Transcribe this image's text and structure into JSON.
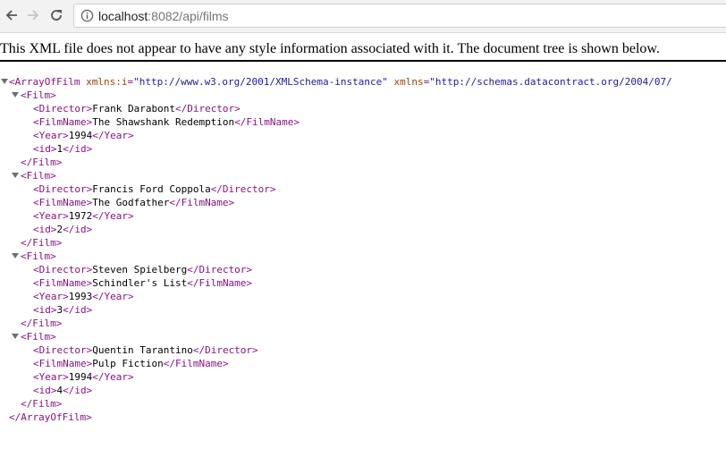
{
  "browser": {
    "url_host": "localhost",
    "url_rest": ":8082/api/films"
  },
  "viewer": {
    "banner": "This XML file does not appear to have any style information associated with it. The document tree is shown below."
  },
  "xml": {
    "root_tag": "ArrayOfFilm",
    "root_attr1_name": "xmlns:i",
    "root_attr1_value": "\"http://www.w3.org/2001/XMLSchema-instance\"",
    "root_attr2_name": "xmlns",
    "root_attr2_value": "\"http://schemas.datacontract.org/2004/07/",
    "film_tag": "Film",
    "fields": [
      "Director",
      "FilmName",
      "Year",
      "id"
    ],
    "films": [
      {
        "Director": "Frank Darabont",
        "FilmName": "The Shawshank Redemption",
        "Year": "1994",
        "id": "1"
      },
      {
        "Director": "Francis Ford Coppola",
        "FilmName": "The Godfather",
        "Year": "1972",
        "id": "2"
      },
      {
        "Director": "Steven Spielberg",
        "FilmName": "Schindler's List",
        "Year": "1993",
        "id": "3"
      },
      {
        "Director": "Quentin Tarantino",
        "FilmName": "Pulp Fiction",
        "Year": "1994",
        "id": "4"
      }
    ]
  }
}
